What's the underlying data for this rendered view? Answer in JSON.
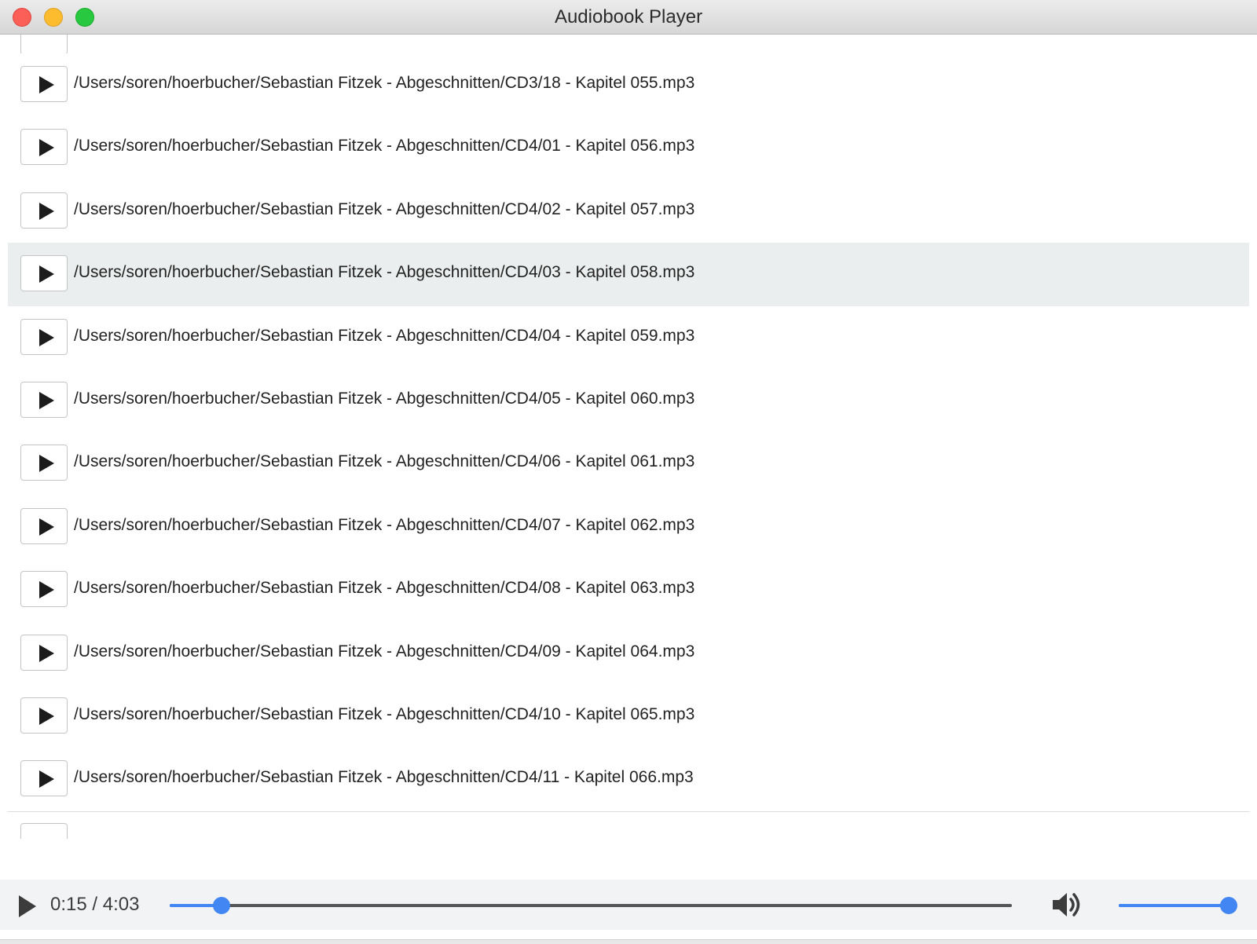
{
  "window": {
    "title": "Audiobook Player"
  },
  "tracks": [
    {
      "path": "/Users/soren/hoerbucher/Sebastian Fitzek - Abgeschnitten/CD3/18 - Kapitel 055.mp3",
      "selected": false
    },
    {
      "path": "/Users/soren/hoerbucher/Sebastian Fitzek - Abgeschnitten/CD4/01 - Kapitel 056.mp3",
      "selected": false
    },
    {
      "path": "/Users/soren/hoerbucher/Sebastian Fitzek - Abgeschnitten/CD4/02 - Kapitel 057.mp3",
      "selected": false
    },
    {
      "path": "/Users/soren/hoerbucher/Sebastian Fitzek - Abgeschnitten/CD4/03 - Kapitel 058.mp3",
      "selected": true
    },
    {
      "path": "/Users/soren/hoerbucher/Sebastian Fitzek - Abgeschnitten/CD4/04 - Kapitel 059.mp3",
      "selected": false
    },
    {
      "path": "/Users/soren/hoerbucher/Sebastian Fitzek - Abgeschnitten/CD4/05 - Kapitel 060.mp3",
      "selected": false
    },
    {
      "path": "/Users/soren/hoerbucher/Sebastian Fitzek - Abgeschnitten/CD4/06 - Kapitel 061.mp3",
      "selected": false
    },
    {
      "path": "/Users/soren/hoerbucher/Sebastian Fitzek - Abgeschnitten/CD4/07 - Kapitel 062.mp3",
      "selected": false
    },
    {
      "path": "/Users/soren/hoerbucher/Sebastian Fitzek - Abgeschnitten/CD4/08 - Kapitel 063.mp3",
      "selected": false
    },
    {
      "path": "/Users/soren/hoerbucher/Sebastian Fitzek - Abgeschnitten/CD4/09 - Kapitel 064.mp3",
      "selected": false
    },
    {
      "path": "/Users/soren/hoerbucher/Sebastian Fitzek - Abgeschnitten/CD4/10 - Kapitel 065.mp3",
      "selected": false
    },
    {
      "path": "/Users/soren/hoerbucher/Sebastian Fitzek - Abgeschnitten/CD4/11 - Kapitel 066.mp3",
      "selected": false
    }
  ],
  "player": {
    "time_label": "0:15 / 4:03",
    "progress_fraction": 0.0617,
    "volume_fraction": 1.0
  },
  "colors": {
    "accent": "#4286f4",
    "selected_row": "#ebeeee",
    "player_bg": "#f1f3f4"
  },
  "icons": {
    "row_play": "play-icon",
    "player_play": "play-icon",
    "volume": "speaker-icon"
  }
}
